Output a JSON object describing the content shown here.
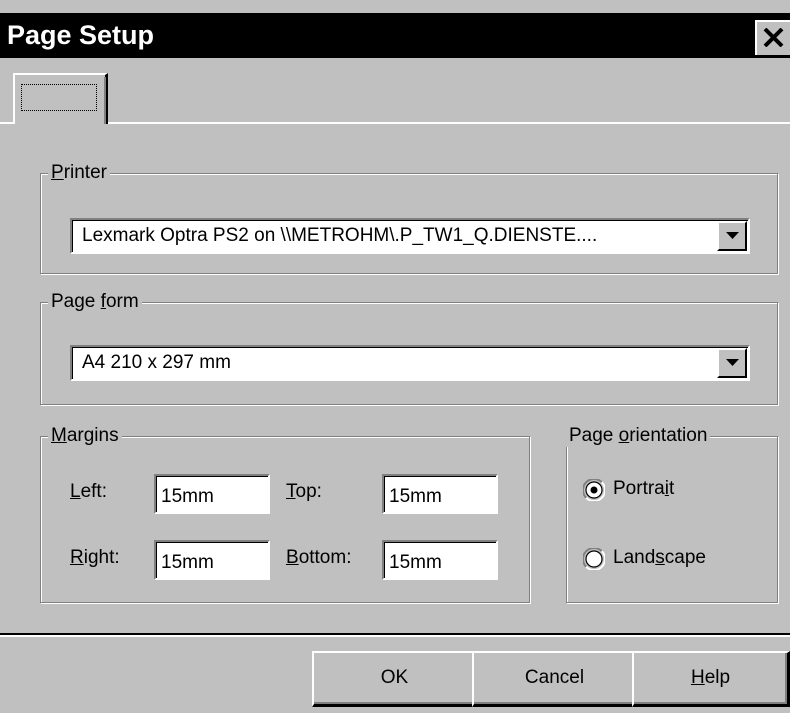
{
  "window": {
    "title": "Page Setup",
    "close_label": "close"
  },
  "tab": {
    "label": ""
  },
  "printer": {
    "legend_prefix": "",
    "legend_mnemonic": "P",
    "legend_suffix": "rinter",
    "selected": "Lexmark Optra PS2 on \\\\METROHM\\.P_TW1_Q.DIENSTE...."
  },
  "page_form": {
    "legend_prefix": "Page ",
    "legend_mnemonic": "f",
    "legend_suffix": "orm",
    "selected": "A4 210 x 297 mm"
  },
  "margins": {
    "legend_prefix": "",
    "legend_mnemonic": "M",
    "legend_suffix": "argins",
    "left": {
      "label_prefix": "",
      "label_mnemonic": "L",
      "label_suffix": "eft:",
      "value": "15mm"
    },
    "top": {
      "label_prefix": "",
      "label_mnemonic": "T",
      "label_suffix": "op:",
      "value": "15mm"
    },
    "right": {
      "label_prefix": "",
      "label_mnemonic": "R",
      "label_suffix": "ight:",
      "value": "15mm"
    },
    "bottom": {
      "label_prefix": "",
      "label_mnemonic": "B",
      "label_suffix": "ottom:",
      "value": "15mm"
    }
  },
  "orientation": {
    "legend_prefix": "Page ",
    "legend_mnemonic": "o",
    "legend_suffix": "rientation",
    "portrait": {
      "label_prefix": "Portra",
      "label_mnemonic": "i",
      "label_suffix": "t",
      "checked": true
    },
    "landscape": {
      "label_prefix": "Land",
      "label_mnemonic": "s",
      "label_suffix": "cape",
      "checked": false
    }
  },
  "buttons": {
    "ok": "OK",
    "cancel": "Cancel",
    "help_mnemonic": "H",
    "help_suffix": "elp"
  },
  "colors": {
    "face": "#c0c0c0",
    "titlebar": "#000000",
    "highlight": "#ffffff",
    "shadow": "#808080"
  }
}
